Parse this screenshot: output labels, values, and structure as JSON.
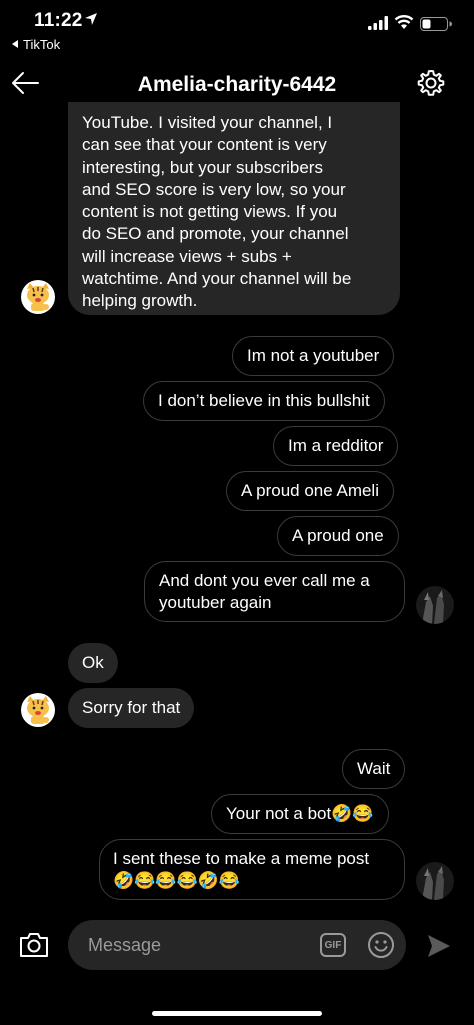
{
  "status_bar": {
    "time": "11:22",
    "back_app": "TikTok"
  },
  "header": {
    "title": "Amelia-charity-6442",
    "back_icon": "arrow-left-icon",
    "settings_icon": "gear-icon"
  },
  "messages": [
    {
      "side": "received",
      "lines": [
        "YouTube.  I visited your channel, I",
        "can see that your content is very",
        "interesting, but your subscribers",
        "and SEO score is very low, so your",
        "content is not getting views.  If you",
        "do SEO and promote, your channel",
        "will increase views + subs +",
        "watchtime.  And your channel will be",
        "helping growth."
      ]
    },
    {
      "side": "sent",
      "text": "Im not a youtuber"
    },
    {
      "side": "sent",
      "text": "I don’t believe in this bullshit"
    },
    {
      "side": "sent",
      "text": "Im a redditor"
    },
    {
      "side": "sent",
      "text": "A proud one Ameli"
    },
    {
      "side": "sent",
      "text": "A proud one"
    },
    {
      "side": "sent",
      "lines": [
        "And dont you ever call me a",
        "youtuber again"
      ]
    },
    {
      "side": "received",
      "text": "Ok"
    },
    {
      "side": "received",
      "text": "Sorry for that"
    },
    {
      "side": "sent",
      "text": "Wait"
    },
    {
      "side": "sent",
      "text": "Your not a bot🤣😂"
    },
    {
      "side": "sent",
      "lines": [
        "I sent these to make a meme post",
        "🤣😂😂😂🤣😂"
      ]
    }
  ],
  "composer": {
    "placeholder": "Message",
    "gif_label": "GIF",
    "camera_icon": "camera-icon",
    "emoji_icon": "smiley-icon",
    "send_icon": "send-icon"
  },
  "colors": {
    "background": "#000000",
    "received_bubble": "#262626",
    "sent_bubble_border": "#3b3b3b",
    "muted_text": "#9a9a9a"
  }
}
